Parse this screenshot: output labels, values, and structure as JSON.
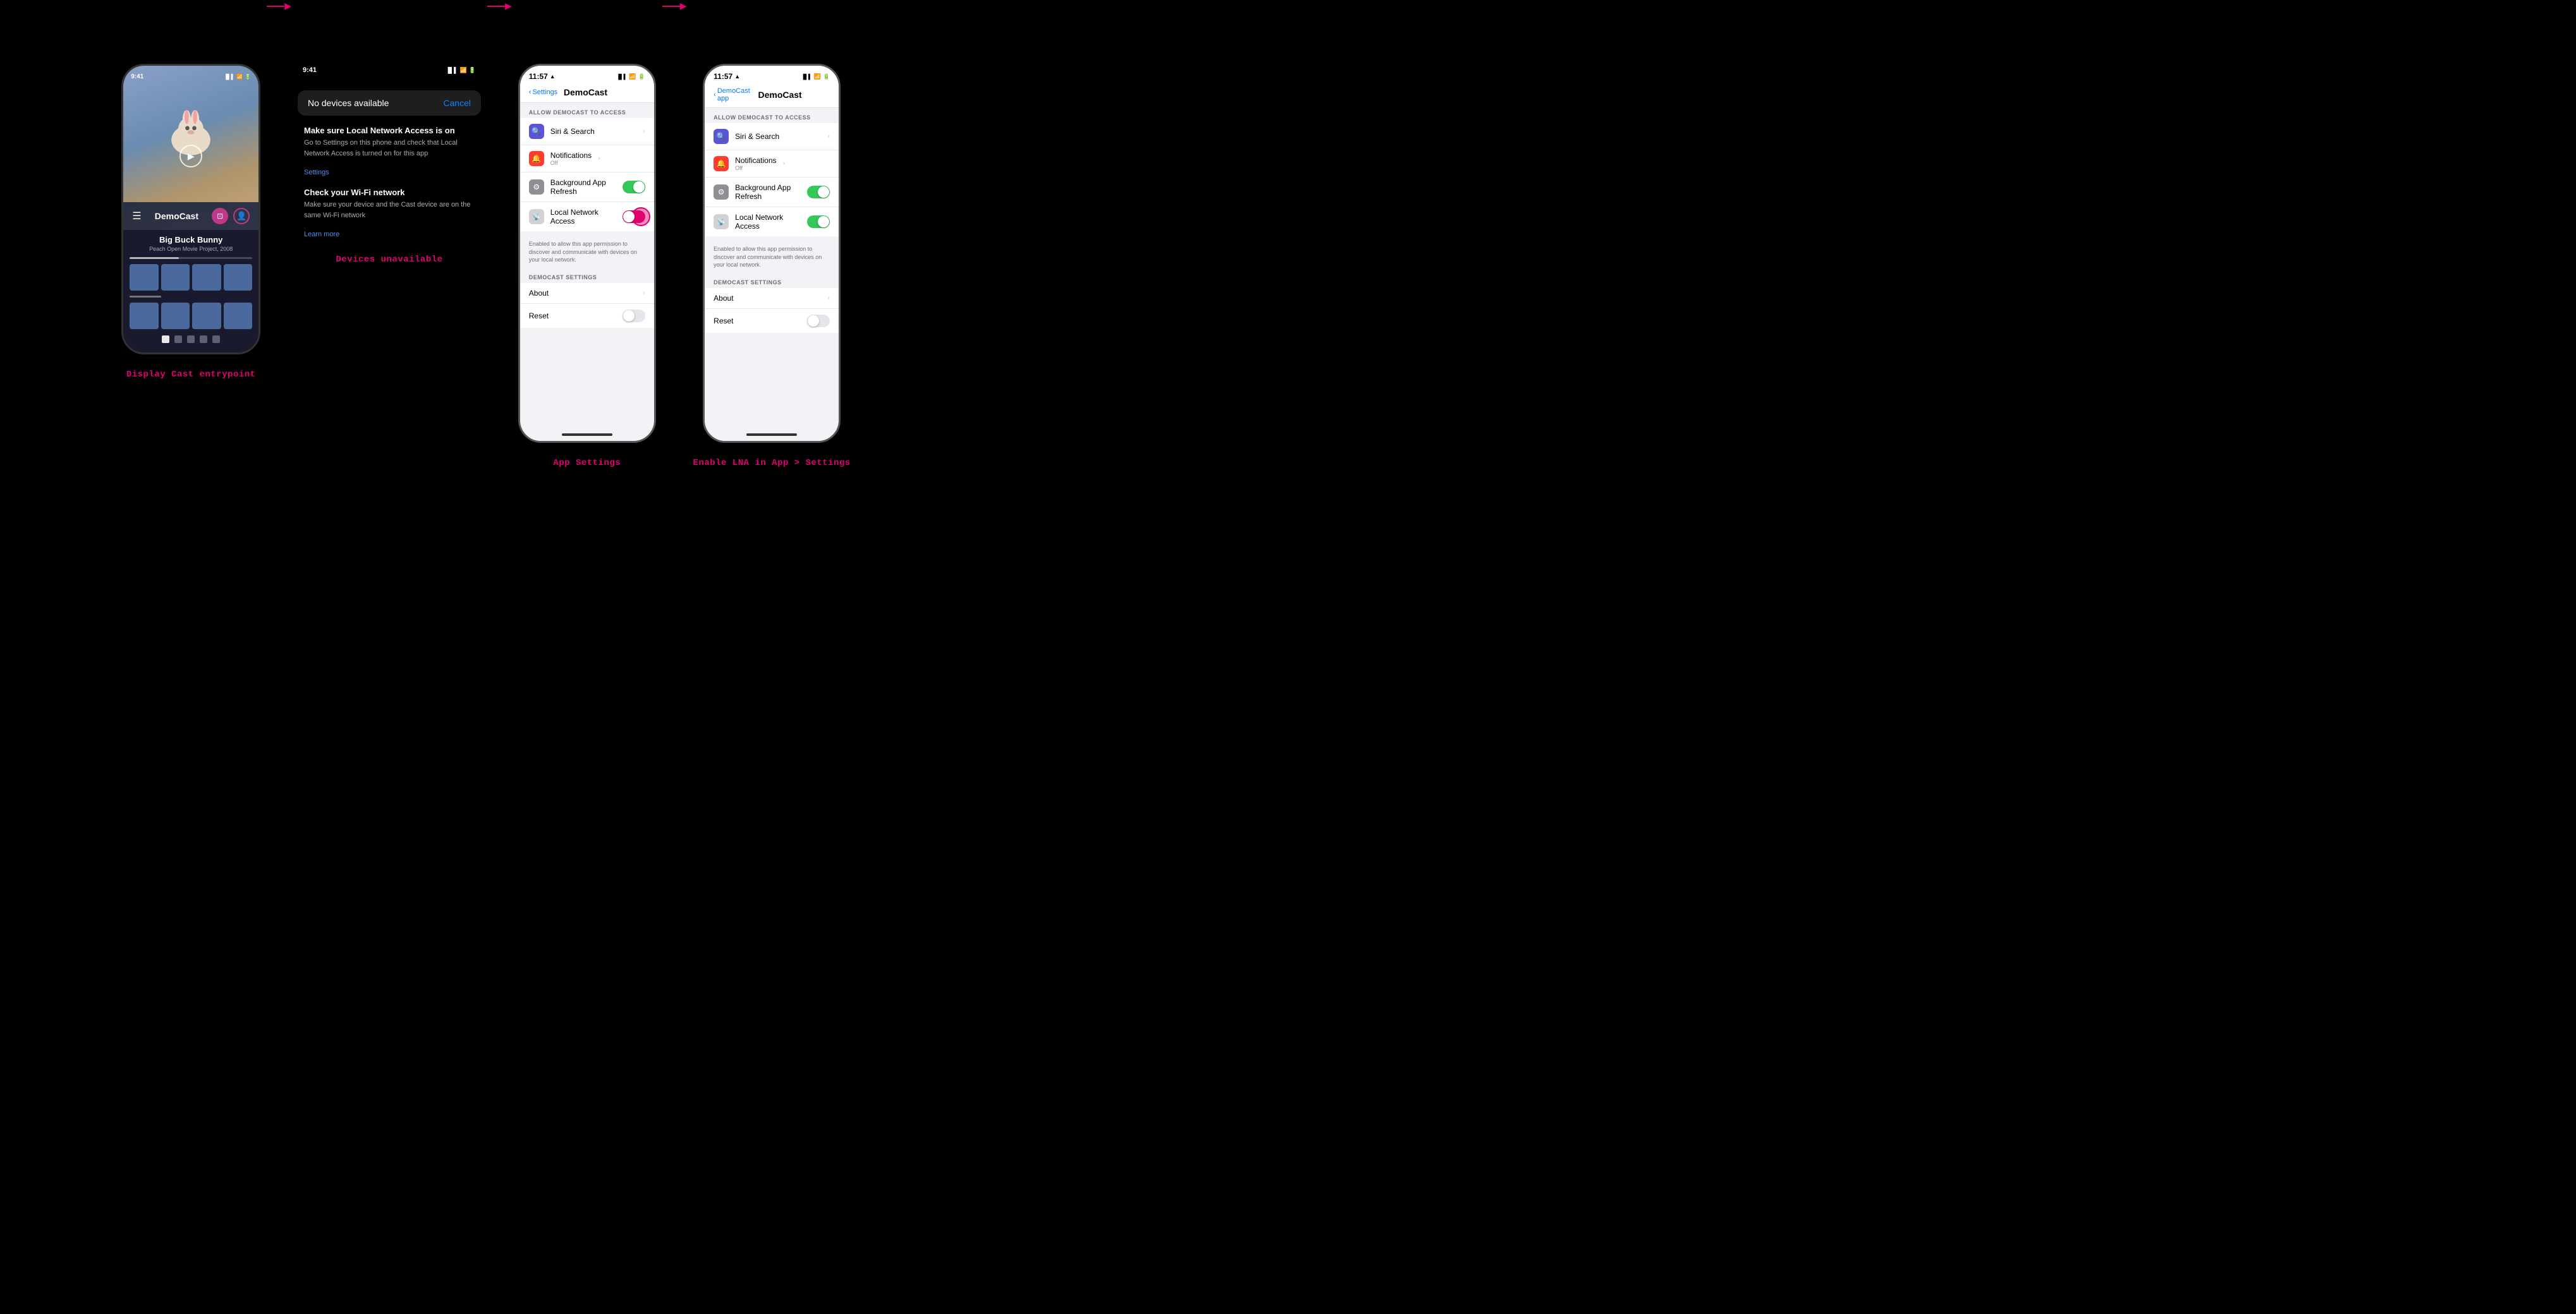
{
  "sections": [
    {
      "id": "display-cast",
      "label": "Display Cast entrypoint",
      "phone": {
        "time": "9:41",
        "title": "DemoCast",
        "movie_title": "Big Buck Bunny",
        "movie_subtitle": "Peach Open Movie Project, 2008"
      }
    },
    {
      "id": "devices-unavailable",
      "label": "Devices unavailable",
      "no_devices": "No devices available",
      "cancel": "Cancel",
      "time": "9:41",
      "instruction1_heading": "Make sure Local Network Access is on",
      "instruction1_text": "Go to Settings on this phone and check that Local Network Access is turned on for this app",
      "instruction1_link": "Settings",
      "instruction2_heading": "Check your Wi-Fi network",
      "instruction2_text": "Make sure your device and the Cast device are on the same Wi-Fi network",
      "instruction2_link": "Learn more"
    },
    {
      "id": "app-settings",
      "label": "App Settings",
      "time": "11:57",
      "back_label": "Settings",
      "page_title": "DemoCast",
      "section_header": "ALLOW DEMOCAST TO ACCESS",
      "rows": [
        {
          "id": "siri",
          "label": "Siri & Search",
          "value": "",
          "type": "chevron",
          "icon": "purple"
        },
        {
          "id": "notifications",
          "label": "Notifications",
          "value": "Off",
          "type": "chevron",
          "icon": "red"
        },
        {
          "id": "background",
          "label": "Background App Refresh",
          "value": "",
          "type": "toggle-on",
          "icon": "gray"
        },
        {
          "id": "lna",
          "label": "Local Network Access",
          "value": "",
          "type": "toggle-pink",
          "icon": "light-gray"
        }
      ],
      "lna_description": "Enabled to allow this app permission to discover and communicate with devices on your local network.",
      "settings_section_header": "DEMOCAST SETTINGS",
      "settings_rows": [
        {
          "id": "about",
          "label": "About",
          "type": "chevron"
        },
        {
          "id": "reset",
          "label": "Reset",
          "type": "toggle-off"
        }
      ]
    },
    {
      "id": "enable-lna",
      "label": "Enable LNA in App > Settings",
      "time": "11:57",
      "back_label": "DemoCast app",
      "page_title": "DemoCast",
      "section_header": "ALLOW DEMOCAST TO ACCESS",
      "rows": [
        {
          "id": "siri",
          "label": "Siri & Search",
          "value": "",
          "type": "chevron",
          "icon": "purple"
        },
        {
          "id": "notifications",
          "label": "Notifications",
          "value": "Off",
          "type": "chevron",
          "icon": "red"
        },
        {
          "id": "background",
          "label": "Background App Refresh",
          "value": "",
          "type": "toggle-on",
          "icon": "gray"
        },
        {
          "id": "lna",
          "label": "Local Network Access",
          "value": "",
          "type": "toggle-on",
          "icon": "light-gray"
        }
      ],
      "lna_description": "Enabled to allow this app permission to discover and communicate with devices on your local network.",
      "settings_section_header": "DEMOCAST SETTINGS",
      "settings_rows": [
        {
          "id": "about",
          "label": "About",
          "type": "chevron"
        },
        {
          "id": "reset",
          "label": "Reset",
          "type": "toggle-off"
        }
      ]
    }
  ]
}
